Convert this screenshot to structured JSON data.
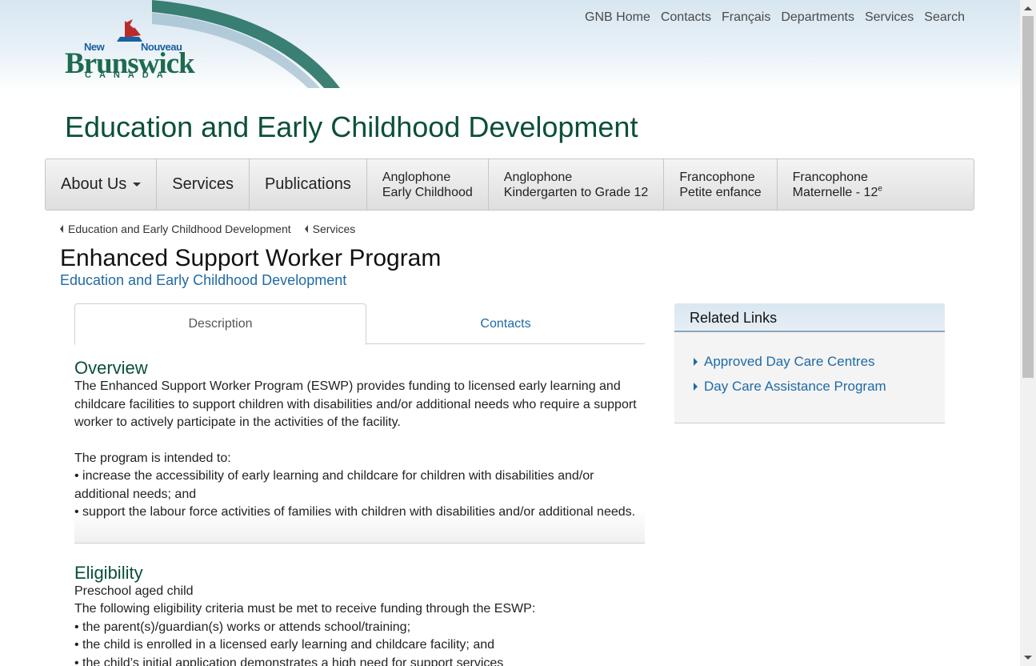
{
  "logo": {
    "new": "New",
    "nouveau": "Nouveau",
    "brunswick": "Brunswick",
    "canada": "CANADA"
  },
  "topnav": [
    "GNB Home",
    "Contacts",
    "Français",
    "Departments",
    "Services",
    "Search"
  ],
  "site_title": "Education and Early Childhood Development",
  "mainnav": {
    "about": "About Us",
    "services": "Services",
    "publications": "Publications",
    "anglo_ec_1": "Anglophone",
    "anglo_ec_2": "Early Childhood",
    "anglo_k12_1": "Anglophone",
    "anglo_k12_2": "Kindergarten to Grade 12",
    "franco_pe_1": "Francophone",
    "franco_pe_2": "Petite enfance",
    "franco_m12_1": "Francophone",
    "franco_m12_2": "Maternelle - 12",
    "franco_m12_sup": "e"
  },
  "breadcrumb": [
    "Education and Early Childhood Development",
    "Services"
  ],
  "page_title": "Enhanced Support Worker Program",
  "page_subtitle": "Education and Early Childhood Development",
  "tabs": {
    "description": "Description",
    "contacts": "Contacts"
  },
  "overview": {
    "heading": "Overview",
    "para1": "The Enhanced Support Worker Program (ESWP) provides funding to licensed early learning and childcare facilities to support children with disabilities and/or additional needs who require a support worker to actively participate in the activities of the facility.",
    "intro": "The program is intended to:",
    "bullet1": "• increase the accessibility of early learning and childcare for children with disabilities and/or additional needs; and",
    "bullet2": "• support the labour force activities of families with children with disabilities and/or additional needs."
  },
  "eligibility": {
    "heading": "Eligibility",
    "line1": "Preschool aged child",
    "line2": "The following eligibility criteria must be met to receive funding through the ESWP:",
    "bullet1": "• the parent(s)/guardian(s) works or attends school/training;",
    "bullet2": "• the child is enrolled in a licensed early learning and childcare facility; and",
    "bullet3": "• the child’s initial application demonstrates a high need for support services"
  },
  "related": {
    "heading": "Related Links",
    "links": [
      "Approved Day Care Centres",
      "Day Care Assistance Program"
    ]
  },
  "colors": {
    "title_green": "#0b4f3b",
    "link_blue": "#1f6aa5",
    "header_blue": "#d7e6f1"
  }
}
